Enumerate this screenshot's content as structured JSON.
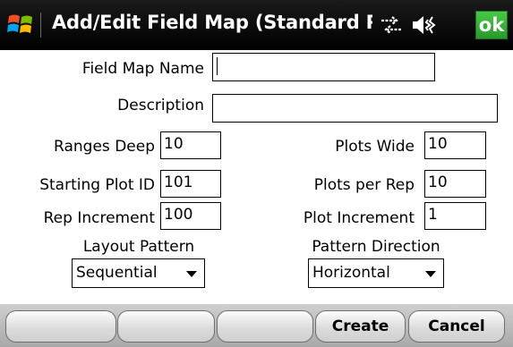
{
  "titlebar": {
    "title": "Add/Edit Field Map (Standard Plot",
    "ok_label": "ok"
  },
  "form": {
    "field_map_name": {
      "label": "Field Map Name",
      "value": ""
    },
    "description": {
      "label": "Description",
      "value": ""
    },
    "ranges_deep": {
      "label": "Ranges Deep",
      "value": "10"
    },
    "plots_wide": {
      "label": "Plots Wide",
      "value": "10"
    },
    "starting_plot_id": {
      "label": "Starting Plot ID",
      "value": "101"
    },
    "plots_per_rep": {
      "label": "Plots per Rep",
      "value": "10"
    },
    "rep_increment": {
      "label": "Rep Increment",
      "value": "100"
    },
    "plot_increment": {
      "label": "Plot Increment",
      "value": "1"
    },
    "layout_pattern": {
      "label": "Layout Pattern",
      "value": "Sequential"
    },
    "pattern_direction": {
      "label": "Pattern Direction",
      "value": "Horizontal"
    }
  },
  "softkeys": {
    "create_label": "Create",
    "cancel_label": "Cancel"
  },
  "colors": {
    "ok_green": "#2fa52f",
    "titlebar_bg": "#000000",
    "softkey_bar_bg": "#bdbdbd"
  },
  "icons": [
    "windows-start-icon",
    "connectivity-icon",
    "volume-icon"
  ]
}
